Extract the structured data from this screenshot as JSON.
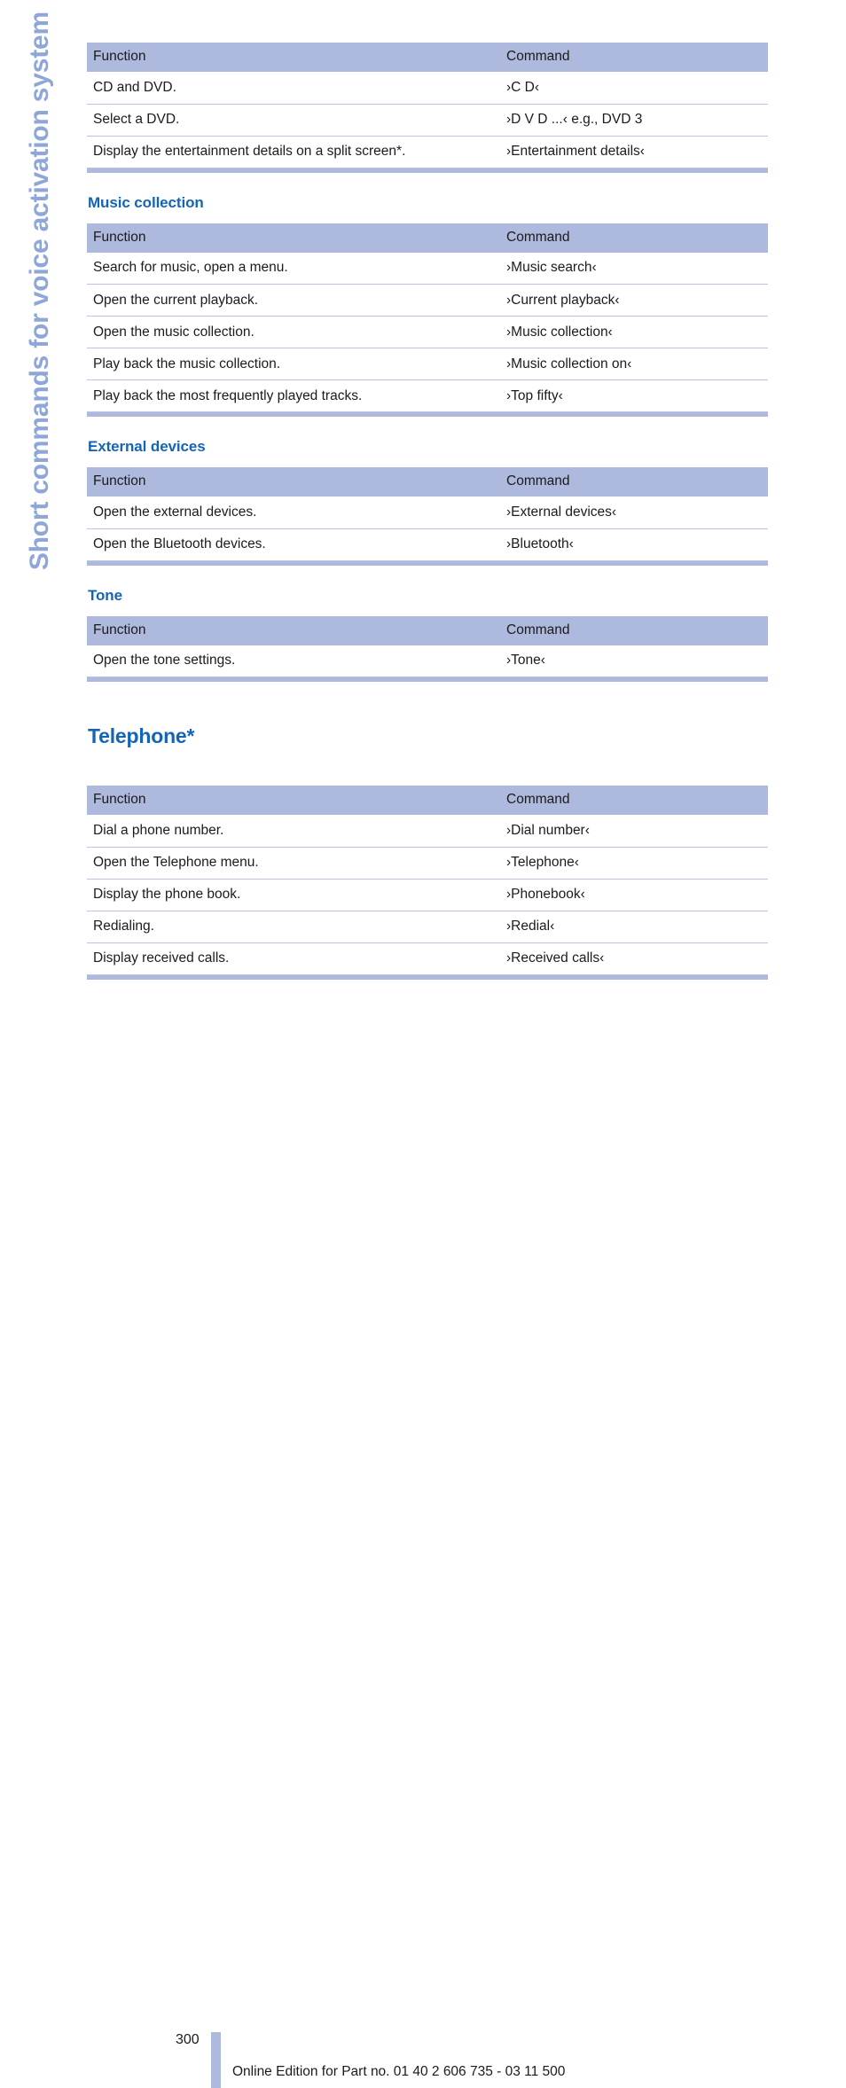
{
  "side_title": "Short commands for voice activation system",
  "colors": {
    "header_fill": "#aeb9de",
    "heading_blue": "#1565b5",
    "side_title_blue": "#8ea7d8",
    "row_rule": "#b9c4e4",
    "text": "#1b1b1b"
  },
  "column_headers": {
    "function": "Function",
    "command": "Command"
  },
  "sections": [
    {
      "heading": null,
      "rows": [
        {
          "function": "CD and DVD.",
          "command": "›C D‹"
        },
        {
          "function": "Select a DVD.",
          "command": "›D V D ...‹ e.g., DVD 3"
        },
        {
          "function": "Display the entertainment details on a split screen*.",
          "command": "›Entertainment details‹"
        }
      ]
    },
    {
      "heading": "Music collection",
      "rows": [
        {
          "function": "Search for music, open a menu.",
          "command": "›Music search‹"
        },
        {
          "function": "Open the current playback.",
          "command": "›Current playback‹"
        },
        {
          "function": "Open the music collection.",
          "command": "›Music collection‹"
        },
        {
          "function": "Play back the music collection.",
          "command": "›Music collection on‹"
        },
        {
          "function": "Play back the most frequently played tracks.",
          "command": "›Top fifty‹"
        }
      ]
    },
    {
      "heading": "External devices",
      "rows": [
        {
          "function": "Open the external devices.",
          "command": "›External devices‹"
        },
        {
          "function": "Open the Bluetooth devices.",
          "command": "›Bluetooth‹"
        }
      ]
    },
    {
      "heading": "Tone",
      "rows": [
        {
          "function": "Open the tone settings.",
          "command": "›Tone‹"
        }
      ]
    }
  ],
  "major_section": {
    "heading": "Telephone*",
    "rows": [
      {
        "function": "Dial a phone number.",
        "command": "›Dial number‹"
      },
      {
        "function": "Open the Telephone menu.",
        "command": "›Telephone‹"
      },
      {
        "function": "Display the phone book.",
        "command": "›Phonebook‹"
      },
      {
        "function": "Redialing.",
        "command": "›Redial‹"
      },
      {
        "function": "Display received calls.",
        "command": "›Received calls‹"
      }
    ]
  },
  "footer": {
    "page_number": "300",
    "note": "Online Edition for Part no. 01 40 2 606 735 - 03 11 500"
  }
}
